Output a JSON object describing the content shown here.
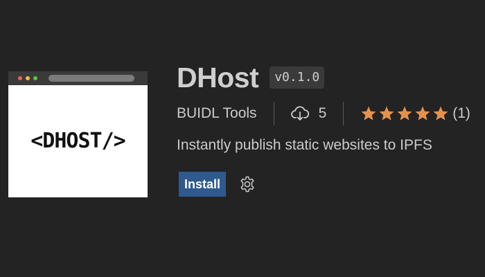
{
  "colors": {
    "background": "#232323",
    "text": "#cccccc",
    "star": "#e5914e",
    "install_button": "#2e5a8e",
    "dot_red": "#ee5f57",
    "dot_yellow": "#f4be3f",
    "dot_green": "#5fc33b"
  },
  "extension": {
    "icon_text": "<DHOST/>",
    "name": "DHost",
    "version": "v0.1.0",
    "publisher": "BUIDL Tools",
    "download_icon": "cloud-download-icon",
    "downloads": "5",
    "rating_stars": 5,
    "rating_count": "(1)",
    "description": "Instantly publish static websites to IPFS"
  },
  "actions": {
    "install_label": "Install",
    "settings_icon": "gear-icon"
  }
}
